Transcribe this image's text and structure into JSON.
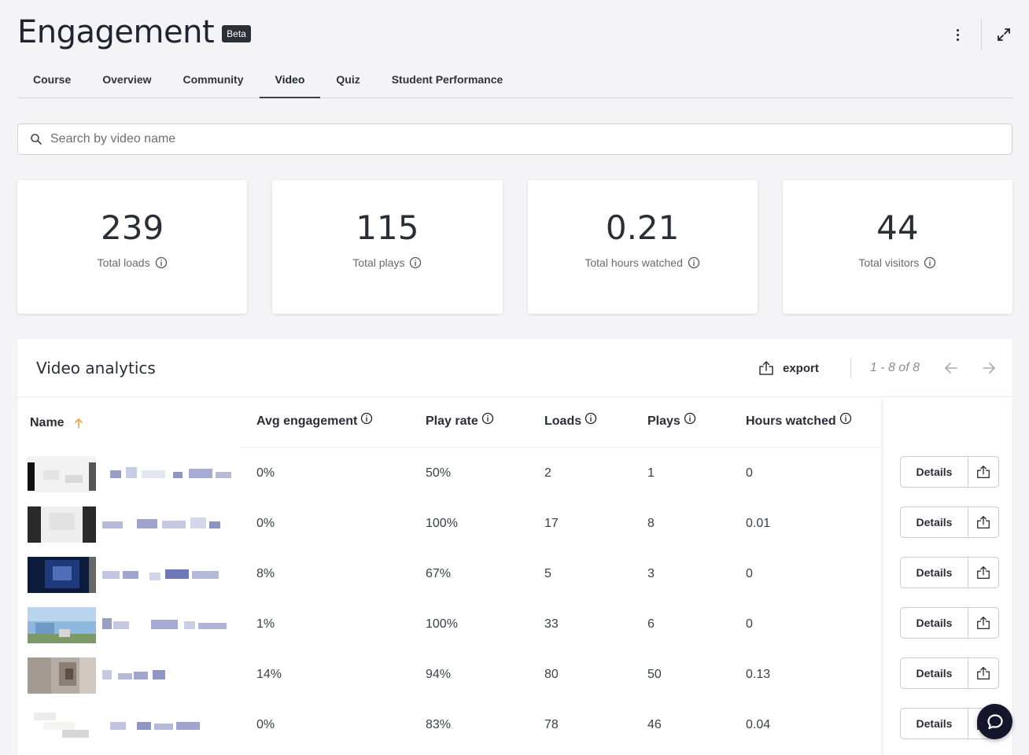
{
  "header": {
    "title": "Engagement",
    "badge": "Beta"
  },
  "tabs": [
    {
      "label": "Course"
    },
    {
      "label": "Overview"
    },
    {
      "label": "Community"
    },
    {
      "label": "Video",
      "active": true
    },
    {
      "label": "Quiz"
    },
    {
      "label": "Student Performance"
    }
  ],
  "search": {
    "placeholder": "Search by video name",
    "value": ""
  },
  "stats": [
    {
      "value": "239",
      "label": "Total loads"
    },
    {
      "value": "115",
      "label": "Total plays"
    },
    {
      "value": "0.21",
      "label": "Total hours watched"
    },
    {
      "value": "44",
      "label": "Total visitors"
    }
  ],
  "analytics": {
    "title": "Video analytics",
    "export_label": "export",
    "pagination": "1 - 8 of 8",
    "columns": {
      "name": "Name",
      "avg_engagement": "Avg engagement",
      "play_rate": "Play rate",
      "loads": "Loads",
      "plays": "Plays",
      "hours_watched": "Hours watched"
    },
    "details_label": "Details",
    "rows": [
      {
        "avg_engagement": "0%",
        "play_rate": "50%",
        "loads": "2",
        "plays": "1",
        "hours_watched": "0"
      },
      {
        "avg_engagement": "0%",
        "play_rate": "100%",
        "loads": "17",
        "plays": "8",
        "hours_watched": "0.01"
      },
      {
        "avg_engagement": "8%",
        "play_rate": "67%",
        "loads": "5",
        "plays": "3",
        "hours_watched": "0"
      },
      {
        "avg_engagement": "1%",
        "play_rate": "100%",
        "loads": "33",
        "plays": "6",
        "hours_watched": "0"
      },
      {
        "avg_engagement": "14%",
        "play_rate": "94%",
        "loads": "80",
        "plays": "50",
        "hours_watched": "0.13"
      },
      {
        "avg_engagement": "0%",
        "play_rate": "83%",
        "loads": "78",
        "plays": "46",
        "hours_watched": "0.04"
      }
    ]
  },
  "colors": {
    "sort_arrow": "#f0a13a",
    "chat_bubble": "#14172b",
    "text_dark": "#2a2e36"
  },
  "icons": [
    "kebab-menu-icon",
    "expand-icon",
    "search-icon",
    "info-icon",
    "export-icon",
    "arrow-left-icon",
    "arrow-right-icon",
    "sort-up-icon",
    "chat-icon"
  ]
}
